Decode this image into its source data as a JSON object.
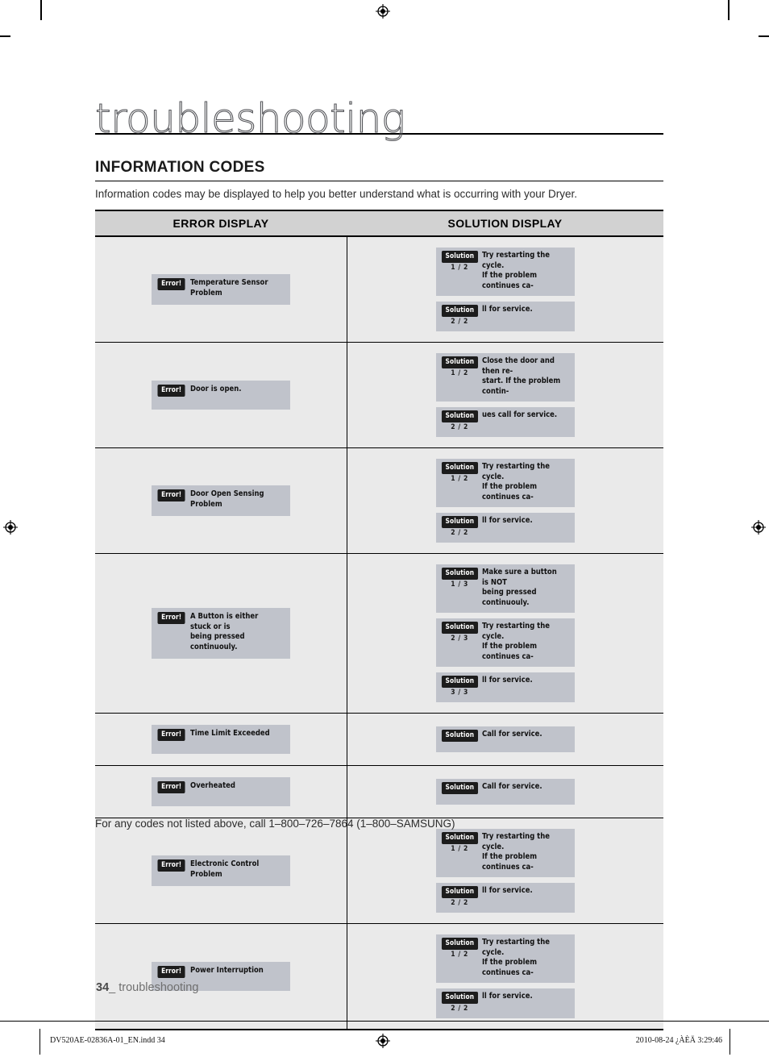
{
  "page": {
    "chapter_title": "troubleshooting",
    "section_heading": "INFORMATION CODES",
    "section_intro": "Information codes may be displayed to help you better understand what is occurring with your Dryer.",
    "table_footnote": "For any codes not listed above, call 1–800–726–7864 (1–800–SAMSUNG)",
    "page_number": "34",
    "page_footer_label": "_ troubleshooting"
  },
  "print_bar": {
    "file": "DV520AE-02836A-01_EN.indd   34",
    "date": "2010-08-24   ¿ÀÈÄ 3:29:46"
  },
  "table": {
    "headers": {
      "error": "ERROR DISPLAY",
      "solution": "SOLUTION DISPLAY"
    },
    "badge_labels": {
      "error": "Error!",
      "solution": "Solution"
    },
    "rows": [
      {
        "error": {
          "text": "Temperature Sensor\nProblem"
        },
        "solutions": [
          {
            "count": "1 / 2",
            "text": "Try restarting the cycle.\nIf the problem continues ca-"
          },
          {
            "count": "2 / 2",
            "text": "ll for service."
          }
        ]
      },
      {
        "error": {
          "text": "Door is open."
        },
        "solutions": [
          {
            "count": "1 / 2",
            "text": "Close the door and then re-\nstart. If the problem contin-"
          },
          {
            "count": "2 / 2",
            "text": "ues call for service."
          }
        ]
      },
      {
        "error": {
          "text": "Door Open Sensing Problem"
        },
        "solutions": [
          {
            "count": "1 / 2",
            "text": "Try restarting the cycle.\nIf the problem continues ca-"
          },
          {
            "count": "2 / 2",
            "text": "ll for service."
          }
        ]
      },
      {
        "error": {
          "text": "A Button is either stuck or is\nbeing pressed continuouly."
        },
        "solutions": [
          {
            "count": "1 / 3",
            "text": "Make sure a button is NOT\nbeing pressed continuouly."
          },
          {
            "count": "2 / 3",
            "text": "Try restarting the cycle.\nIf the problem continues ca-"
          },
          {
            "count": "3 / 3",
            "text": "ll for service."
          }
        ]
      },
      {
        "error": {
          "text": "Time Limit Exceeded"
        },
        "solutions": [
          {
            "count": "",
            "text": "Call for service."
          }
        ]
      },
      {
        "error": {
          "text": "Overheated"
        },
        "solutions": [
          {
            "count": "",
            "text": "Call for service."
          }
        ]
      },
      {
        "error": {
          "text": "Electronic Control Problem"
        },
        "solutions": [
          {
            "count": "1 / 2",
            "text": "Try restarting the cycle.\nIf the problem continues ca-"
          },
          {
            "count": "2 / 2",
            "text": "ll for service."
          }
        ]
      },
      {
        "error": {
          "text": "Power Interruption"
        },
        "solutions": [
          {
            "count": "1 / 2",
            "text": "Try restarting the cycle.\nIf the problem continues ca-"
          },
          {
            "count": "2 / 2",
            "text": "ll for service."
          }
        ]
      }
    ]
  },
  "colors": {
    "lcd_panel": "#c0c3cb",
    "badge": "#1c1c1c",
    "table_header": "#d2d2d2",
    "table_row": "#eaeaea"
  }
}
